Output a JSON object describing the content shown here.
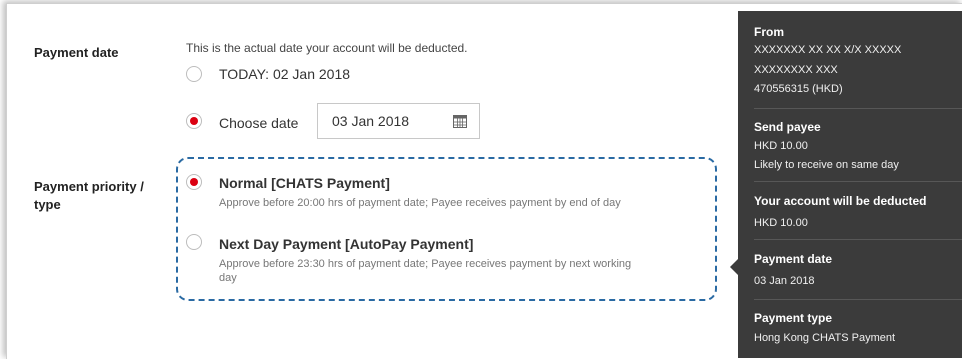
{
  "payment_date": {
    "label": "Payment date",
    "note": "This is the actual date your account will be deducted.",
    "option_today": "TODAY: 02 Jan 2018",
    "option_choose": "Choose date",
    "date_value": "03 Jan 2018",
    "selected": "choose"
  },
  "priority": {
    "label_line1": "Payment priority /",
    "label_line2": "type",
    "options": [
      {
        "title": "Normal [CHATS Payment]",
        "desc": "Approve before 20:00 hrs of payment date; Payee receives payment by end of day",
        "desc2": "",
        "selected": true
      },
      {
        "title": "Next Day Payment [AutoPay Payment]",
        "desc": "Approve before 23:30 hrs of payment date; Payee receives payment by next working",
        "desc2": "day",
        "selected": false
      }
    ]
  },
  "summary": {
    "from_label": "From",
    "from_line1": "XXXXXXX XX XX X/X XXXXX",
    "from_line2": "XXXXXXXX XXX",
    "from_line3": "470556315 (HKD)",
    "payee_label": "Send payee",
    "payee_amount": "HKD 10.00",
    "payee_note": "Likely to receive on same day",
    "deduct_label": "Your account will be deducted",
    "deduct_amount": "HKD 10.00",
    "date_label": "Payment date",
    "date_value": "03 Jan 2018",
    "type_label": "Payment type",
    "type_value": "Hong Kong CHATS Payment"
  },
  "colors": {
    "accent_red": "#db0011",
    "panel_bg": "#3b3b3b",
    "dash_border": "#2a6aa3"
  },
  "icons": {
    "date_picker": "calendar-icon"
  }
}
